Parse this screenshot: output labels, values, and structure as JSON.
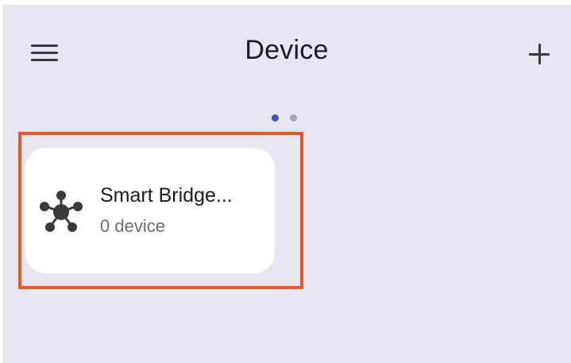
{
  "header": {
    "title": "Device",
    "menu_icon": "hamburger-menu-icon",
    "add_icon": "plus-icon"
  },
  "pager": {
    "page_count": 2,
    "current_page": 1
  },
  "devices": [
    {
      "name": "Smart Bridge...",
      "status": "0 device",
      "icon": "hub-network-icon",
      "selected": true
    }
  ],
  "colors": {
    "background": "#e8e7f0",
    "card": "#ffffff",
    "highlight": "#e8572a",
    "pager_active": "#3f55b5",
    "pager_inactive": "#a5a5aa",
    "icon": "#3a3a3c"
  }
}
